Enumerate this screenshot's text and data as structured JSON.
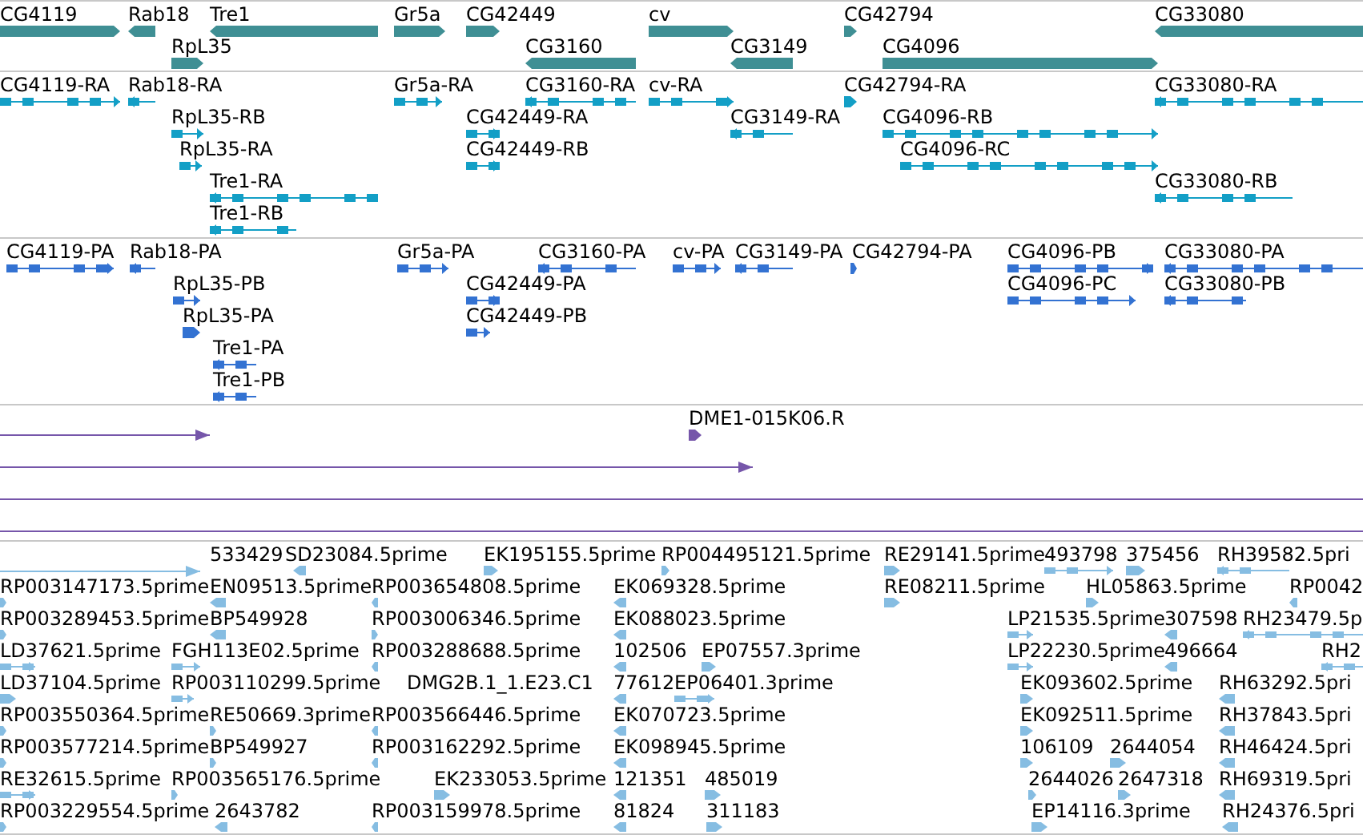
{
  "tracks": [
    {
      "kind": "gene",
      "features": [
        {
          "label": "CG4119"
        },
        {
          "label": "Rab18"
        },
        {
          "label": "Tre1"
        },
        {
          "label": "Gr5a"
        },
        {
          "label": "CG42449"
        },
        {
          "label": "cv"
        },
        {
          "label": "CG42794"
        },
        {
          "label": "CG33080"
        },
        {
          "label": "RpL35"
        },
        {
          "label": "CG3160"
        },
        {
          "label": "CG3149"
        },
        {
          "label": "CG4096"
        }
      ]
    },
    {
      "kind": "transcript",
      "features": [
        {
          "label": "CG4119-RA"
        },
        {
          "label": "Rab18-RA"
        },
        {
          "label": "Gr5a-RA"
        },
        {
          "label": "CG3160-RA"
        },
        {
          "label": "cv-RA"
        },
        {
          "label": "CG42794-RA"
        },
        {
          "label": "CG33080-RA"
        },
        {
          "label": "RpL35-RB"
        },
        {
          "label": "CG42449-RA"
        },
        {
          "label": "CG3149-RA"
        },
        {
          "label": "CG4096-RB"
        },
        {
          "label": "RpL35-RA"
        },
        {
          "label": "CG42449-RB"
        },
        {
          "label": "CG4096-RC"
        },
        {
          "label": "Tre1-RA"
        },
        {
          "label": "CG33080-RB"
        },
        {
          "label": "Tre1-RB"
        }
      ]
    },
    {
      "kind": "protein",
      "features": [
        {
          "label": "CG4119-PA"
        },
        {
          "label": "Rab18-PA"
        },
        {
          "label": "Gr5a-PA"
        },
        {
          "label": "CG3160-PA"
        },
        {
          "label": "cv-PA"
        },
        {
          "label": "CG3149-PA"
        },
        {
          "label": "CG42794-PA"
        },
        {
          "label": "CG4096-PB"
        },
        {
          "label": "CG33080-PA"
        },
        {
          "label": "RpL35-PB"
        },
        {
          "label": "CG42449-PA"
        },
        {
          "label": "CG4096-PC"
        },
        {
          "label": "CG33080-PB"
        },
        {
          "label": "RpL35-PA"
        },
        {
          "label": "CG42449-PB"
        },
        {
          "label": "Tre1-PA"
        },
        {
          "label": "Tre1-PB"
        }
      ]
    },
    {
      "kind": "clone",
      "features": [
        {
          "label": "DME1-015K06.R"
        }
      ]
    },
    {
      "kind": "est",
      "features": [
        {
          "label": "533429"
        },
        {
          "label": "SD23084.5prime"
        },
        {
          "label": "EK195155.5prime"
        },
        {
          "label": "RP004495121.5prime"
        },
        {
          "label": "RE29141.5prime"
        },
        {
          "label": "493798"
        },
        {
          "label": "375456"
        },
        {
          "label": "RH39582.5pri"
        },
        {
          "label": "RP003147173.5prime"
        },
        {
          "label": "EN09513.5prime"
        },
        {
          "label": "RP003654808.5prime"
        },
        {
          "label": "EK069328.5prime"
        },
        {
          "label": "RE08211.5prime"
        },
        {
          "label": "HL05863.5prime"
        },
        {
          "label": "RP0042"
        },
        {
          "label": "RP003289453.5prime"
        },
        {
          "label": "BP549928"
        },
        {
          "label": "RP003006346.5prime"
        },
        {
          "label": "EK088023.5prime"
        },
        {
          "label": "LP21535.5prime"
        },
        {
          "label": "307598"
        },
        {
          "label": "RH23479.5p"
        },
        {
          "label": "LD37621.5prime"
        },
        {
          "label": "FGH113E02.5prime"
        },
        {
          "label": "RP003288688.5prime"
        },
        {
          "label": "102506"
        },
        {
          "label": "EP07557.3prime"
        },
        {
          "label": "LP22230.5prime"
        },
        {
          "label": "496664"
        },
        {
          "label": "RH2"
        },
        {
          "label": "LD37104.5prime"
        },
        {
          "label": "RP003110299.5prime"
        },
        {
          "label": "DMG2B.1_1.E23.C1"
        },
        {
          "label": "77612"
        },
        {
          "label": "EP06401.3prime"
        },
        {
          "label": "EK093602.5prime"
        },
        {
          "label": "RH63292.5pri"
        },
        {
          "label": "RP003550364.5prime"
        },
        {
          "label": "RE50669.3prime"
        },
        {
          "label": "RP003566446.5prime"
        },
        {
          "label": "EK070723.5prime"
        },
        {
          "label": "EK092511.5prime"
        },
        {
          "label": "RH37843.5pri"
        },
        {
          "label": "RP003577214.5prime"
        },
        {
          "label": "BP549927"
        },
        {
          "label": "RP003162292.5prime"
        },
        {
          "label": "EK098945.5prime"
        },
        {
          "label": "106109"
        },
        {
          "label": "2644054"
        },
        {
          "label": "RH46424.5pri"
        },
        {
          "label": "RE32615.5prime"
        },
        {
          "label": "RP003565176.5prime"
        },
        {
          "label": "EK233053.5prime"
        },
        {
          "label": "121351"
        },
        {
          "label": "485019"
        },
        {
          "label": "2644026"
        },
        {
          "label": "2647318"
        },
        {
          "label": "RH69319.5pri"
        },
        {
          "label": "RP003229554.5prime"
        },
        {
          "label": "2643782"
        },
        {
          "label": "RP003159978.5prime"
        },
        {
          "label": "81824"
        },
        {
          "label": "311183"
        },
        {
          "label": "EP14116.3prime"
        },
        {
          "label": "RH24376.5pri"
        }
      ]
    }
  ]
}
